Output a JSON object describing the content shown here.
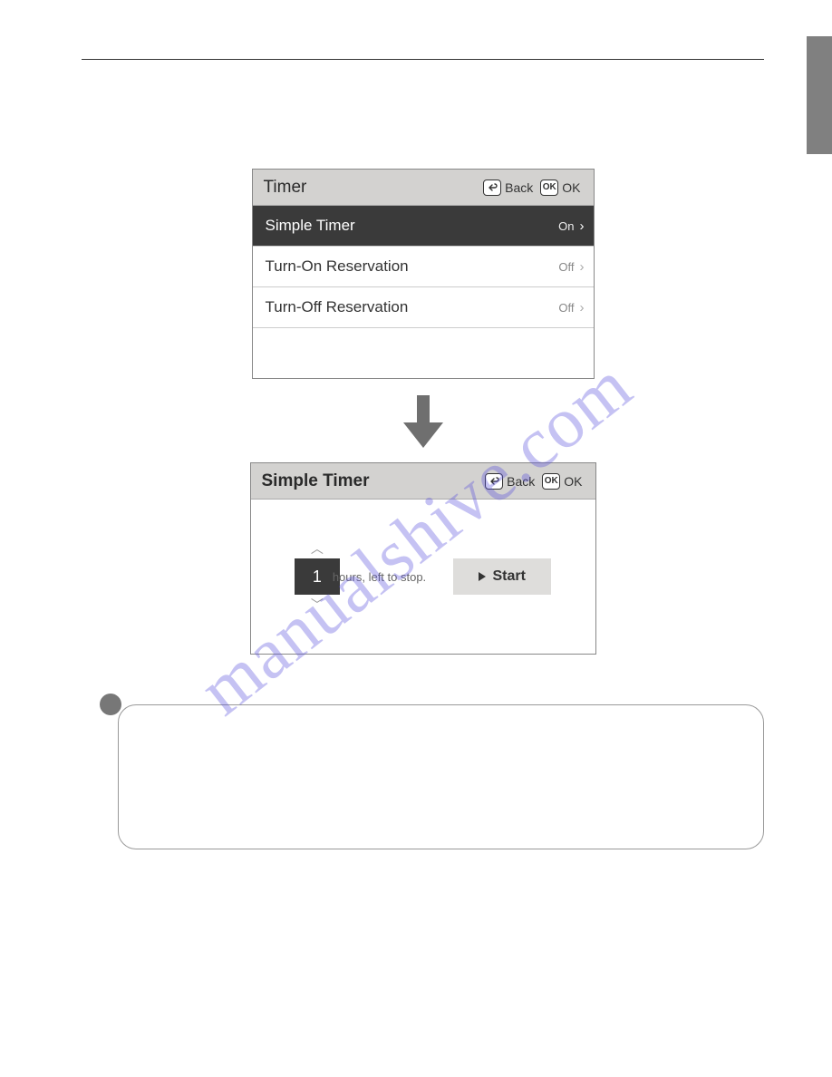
{
  "panel1": {
    "title": "Timer",
    "back_label": "Back",
    "ok_label": "OK",
    "back_icon_glyph": "↩",
    "ok_icon_glyph": "OK",
    "rows": [
      {
        "label": "Simple Timer",
        "value": "On"
      },
      {
        "label": "Turn-On Reservation",
        "value": "Off"
      },
      {
        "label": "Turn-Off Reservation",
        "value": "Off"
      }
    ]
  },
  "panel2": {
    "title": "Simple Timer",
    "back_label": "Back",
    "ok_label": "OK",
    "hours_value": "1",
    "hours_caption": "hours, left to stop.",
    "start_label": "Start"
  },
  "watermark": "manualshive.com"
}
